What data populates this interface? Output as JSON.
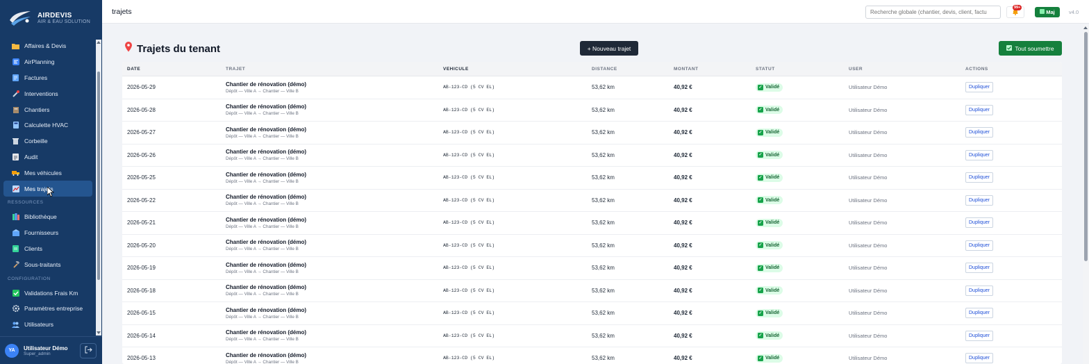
{
  "brand": {
    "name": "AIRDEVIS",
    "tagline": "AIR & EAU SOLUTION"
  },
  "sidebar": {
    "items": [
      {
        "label": "Affaires & Devis",
        "icon": "folder-icon",
        "active": false
      },
      {
        "label": "AirPlanning",
        "icon": "planning-icon",
        "active": false
      },
      {
        "label": "Factures",
        "icon": "invoice-icon",
        "active": false
      },
      {
        "label": "Interventions",
        "icon": "tools-icon",
        "active": false
      },
      {
        "label": "Chantiers",
        "icon": "building-icon",
        "active": false
      },
      {
        "label": "Calculette HVAC",
        "icon": "calculator-icon",
        "active": false
      },
      {
        "label": "Corbeille",
        "icon": "trash-icon",
        "active": false
      },
      {
        "label": "Audit",
        "icon": "clipboard-icon",
        "active": false
      },
      {
        "label": "Mes véhicules",
        "icon": "truck-icon",
        "active": false
      },
      {
        "label": "Mes trajets",
        "icon": "map-icon",
        "active": true
      }
    ],
    "section_resources": "RESSOURCES",
    "resources": [
      {
        "label": "Bibliothèque",
        "icon": "books-icon"
      },
      {
        "label": "Fournisseurs",
        "icon": "supplier-icon"
      },
      {
        "label": "Clients",
        "icon": "clients-icon"
      },
      {
        "label": "Sous-traitants",
        "icon": "hammer-icon"
      }
    ],
    "section_config": "CONFIGURATION",
    "config": [
      {
        "label": "Validations Frais Km",
        "icon": "check-square-icon"
      },
      {
        "label": "Paramètres entreprise",
        "icon": "settings-icon"
      },
      {
        "label": "Utilisateurs",
        "icon": "users-icon"
      }
    ],
    "user": {
      "initials": "YA",
      "name": "Utilisateur Démo",
      "role": "Super_admin"
    }
  },
  "topbar": {
    "page": "trajets",
    "search_placeholder": "Recherche globale (chantier, devis, client, factu",
    "notif_badge": "99+",
    "maj_label": "Maj",
    "version": "v4.0"
  },
  "main": {
    "title": "Trajets du tenant",
    "new_button": "+ Nouveau trajet",
    "submit_all_button": "Tout soumettre",
    "columns": [
      "DATE",
      "TRAJET",
      "VEHICULE",
      "DISTANCE",
      "MONTANT",
      "STATUT",
      "USER",
      "ACTIONS"
    ],
    "rows": [
      {
        "date": "2026-05-29",
        "title": "Chantier de rénovation (démo)",
        "route": "Dépôt — Ville A → Chantier — Ville B",
        "vehicle": "AB-123-CD (5 CV EL)",
        "distance": "53,62 km",
        "amount": "40,92 €",
        "status": "Validé",
        "user": "Utilisateur Démo",
        "action": "Dupliquer"
      },
      {
        "date": "2026-05-28",
        "title": "Chantier de rénovation (démo)",
        "route": "Dépôt — Ville A → Chantier — Ville B",
        "vehicle": "AB-123-CD (5 CV EL)",
        "distance": "53,62 km",
        "amount": "40,92 €",
        "status": "Validé",
        "user": "Utilisateur Démo",
        "action": "Dupliquer"
      },
      {
        "date": "2026-05-27",
        "title": "Chantier de rénovation (démo)",
        "route": "Dépôt — Ville A → Chantier — Ville B",
        "vehicle": "AB-123-CD (5 CV EL)",
        "distance": "53,62 km",
        "amount": "40,92 €",
        "status": "Validé",
        "user": "Utilisateur Démo",
        "action": "Dupliquer"
      },
      {
        "date": "2026-05-26",
        "title": "Chantier de rénovation (démo)",
        "route": "Dépôt — Ville A → Chantier — Ville B",
        "vehicle": "AB-123-CD (5 CV EL)",
        "distance": "53,62 km",
        "amount": "40,92 €",
        "status": "Validé",
        "user": "Utilisateur Démo",
        "action": "Dupliquer"
      },
      {
        "date": "2026-05-25",
        "title": "Chantier de rénovation (démo)",
        "route": "Dépôt — Ville A → Chantier — Ville B",
        "vehicle": "AB-123-CD (5 CV EL)",
        "distance": "53,62 km",
        "amount": "40,92 €",
        "status": "Validé",
        "user": "Utilisateur Démo",
        "action": "Dupliquer"
      },
      {
        "date": "2026-05-22",
        "title": "Chantier de rénovation (démo)",
        "route": "Dépôt — Ville A → Chantier — Ville B",
        "vehicle": "AB-123-CD (5 CV EL)",
        "distance": "53,62 km",
        "amount": "40,92 €",
        "status": "Validé",
        "user": "Utilisateur Démo",
        "action": "Dupliquer"
      },
      {
        "date": "2026-05-21",
        "title": "Chantier de rénovation (démo)",
        "route": "Dépôt — Ville A → Chantier — Ville B",
        "vehicle": "AB-123-CD (5 CV EL)",
        "distance": "53,62 km",
        "amount": "40,92 €",
        "status": "Validé",
        "user": "Utilisateur Démo",
        "action": "Dupliquer"
      },
      {
        "date": "2026-05-20",
        "title": "Chantier de rénovation (démo)",
        "route": "Dépôt — Ville A → Chantier — Ville B",
        "vehicle": "AB-123-CD (5 CV EL)",
        "distance": "53,62 km",
        "amount": "40,92 €",
        "status": "Validé",
        "user": "Utilisateur Démo",
        "action": "Dupliquer"
      },
      {
        "date": "2026-05-19",
        "title": "Chantier de rénovation (démo)",
        "route": "Dépôt — Ville A → Chantier — Ville B",
        "vehicle": "AB-123-CD (5 CV EL)",
        "distance": "53,62 km",
        "amount": "40,92 €",
        "status": "Validé",
        "user": "Utilisateur Démo",
        "action": "Dupliquer"
      },
      {
        "date": "2026-05-18",
        "title": "Chantier de rénovation (démo)",
        "route": "Dépôt — Ville A → Chantier — Ville B",
        "vehicle": "AB-123-CD (5 CV EL)",
        "distance": "53,62 km",
        "amount": "40,92 €",
        "status": "Validé",
        "user": "Utilisateur Démo",
        "action": "Dupliquer"
      },
      {
        "date": "2026-05-15",
        "title": "Chantier de rénovation (démo)",
        "route": "Dépôt — Ville A → Chantier — Ville B",
        "vehicle": "AB-123-CD (5 CV EL)",
        "distance": "53,62 km",
        "amount": "40,92 €",
        "status": "Validé",
        "user": "Utilisateur Démo",
        "action": "Dupliquer"
      },
      {
        "date": "2026-05-14",
        "title": "Chantier de rénovation (démo)",
        "route": "Dépôt — Ville A → Chantier — Ville B",
        "vehicle": "AB-123-CD (5 CV EL)",
        "distance": "53,62 km",
        "amount": "40,92 €",
        "status": "Validé",
        "user": "Utilisateur Démo",
        "action": "Dupliquer"
      },
      {
        "date": "2026-05-13",
        "title": "Chantier de rénovation (démo)",
        "route": "Dépôt — Ville A → Chantier — Ville B",
        "vehicle": "AB-123-CD (5 CV EL)",
        "distance": "53,62 km",
        "amount": "40,92 €",
        "status": "Validé",
        "user": "Utilisateur Démo",
        "action": "Dupliquer"
      }
    ]
  },
  "colors": {
    "sidebar_bg": "#173a66",
    "sidebar_active": "#24558f",
    "accent_green": "#15803d",
    "dark_button": "#1f2937"
  }
}
